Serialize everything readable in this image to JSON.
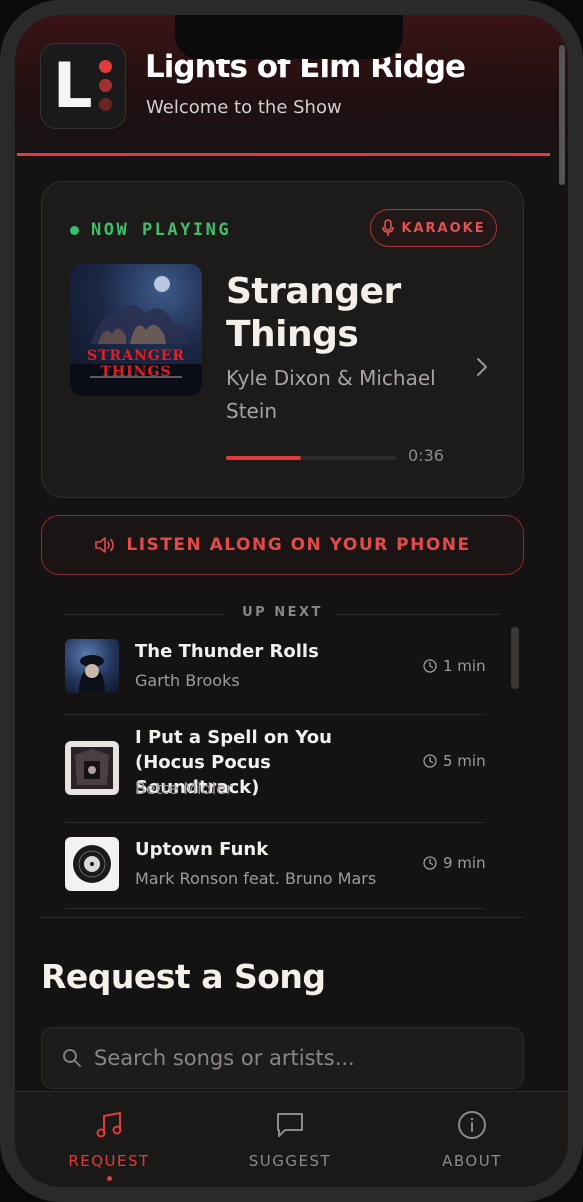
{
  "header": {
    "title": "Lights of Elm Ridge",
    "subtitle": "Welcome to the Show",
    "logo_letter": "L",
    "logo_icon": "show-logo"
  },
  "now_playing": {
    "status_label": "NOW PLAYING",
    "karaoke_label": "KARAOKE",
    "song_title": "Stranger Things",
    "artist": "Kyle Dixon & Michael Stein",
    "album_art_text": "STRANGER THINGS",
    "progress_fraction": 0.44,
    "elapsed": "0:36"
  },
  "listen_along": {
    "label": "LISTEN ALONG ON YOUR PHONE"
  },
  "up_next": {
    "heading": "UP NEXT",
    "items": [
      {
        "title": "The Thunder Rolls",
        "artist": "Garth Brooks",
        "eta": "1 min"
      },
      {
        "title": "I Put a Spell on You (Hocus Pocus Soundtrack)",
        "artist": "Bette Midler",
        "eta": "5 min"
      },
      {
        "title": "Uptown Funk",
        "artist": "Mark Ronson feat. Bruno Mars",
        "eta": "9 min"
      }
    ]
  },
  "request": {
    "title": "Request a Song",
    "search_placeholder": "Search songs or artists..."
  },
  "nav": {
    "items": [
      {
        "label": "REQUEST",
        "icon": "music-note-icon",
        "active": true
      },
      {
        "label": "SUGGEST",
        "icon": "chat-icon",
        "active": false
      },
      {
        "label": "ABOUT",
        "icon": "info-icon",
        "active": false
      }
    ]
  },
  "colors": {
    "accent_red": "#e03c3c",
    "now_playing_green": "#3fbf6b",
    "background": "#141212"
  }
}
